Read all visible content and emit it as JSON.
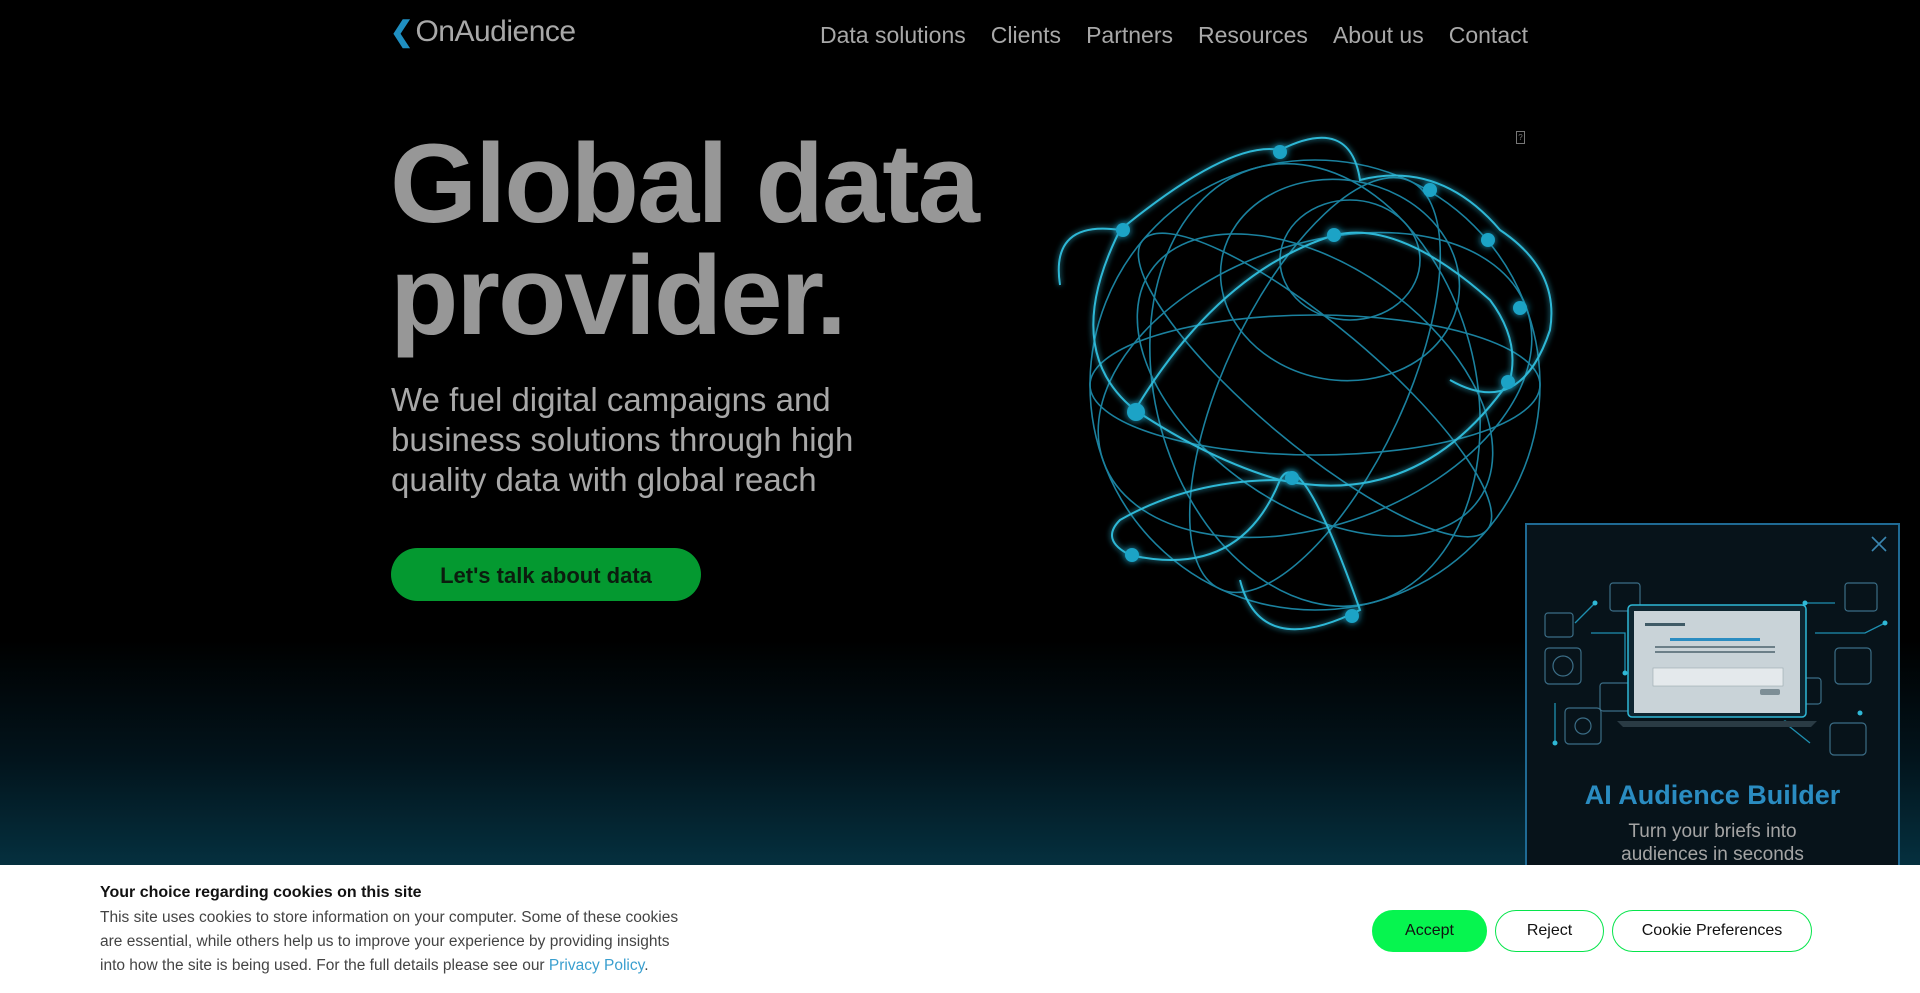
{
  "header": {
    "logo_mark": "❮",
    "logo_text": "OnAudience",
    "nav": [
      "Data solutions",
      "Clients",
      "Partners",
      "Resources",
      "About us",
      "Contact"
    ]
  },
  "hero": {
    "title_line1": "Global data",
    "title_line2": "provider.",
    "subtitle": "We fuel digital campaigns and business solutions through high quality data with global reach",
    "cta_label": "Let's talk about data"
  },
  "promo": {
    "title": "AI Audience Builder",
    "text": "Turn your briefs into audiences in seconds"
  },
  "cookie": {
    "title": "Your choice regarding cookies on this site",
    "text": "This site uses cookies to store information on your computer. Some of these cookies are essential, while others help us to improve your experience by providing insights into how the site is being used. For the full details please see our ",
    "link_text": "Privacy Policy",
    "text_end": ".",
    "accept_label": "Accept",
    "reject_label": "Reject",
    "preferences_label": "Cookie Preferences"
  },
  "colors": {
    "accent_blue": "#1f8fc1",
    "cta_green": "#049930",
    "accept_green": "#06f54f",
    "globe_cyan": "#2fb8d6"
  },
  "icons": {
    "globe": "globe-network-icon",
    "close": "close-icon",
    "tiny": "broken-image-icon"
  }
}
